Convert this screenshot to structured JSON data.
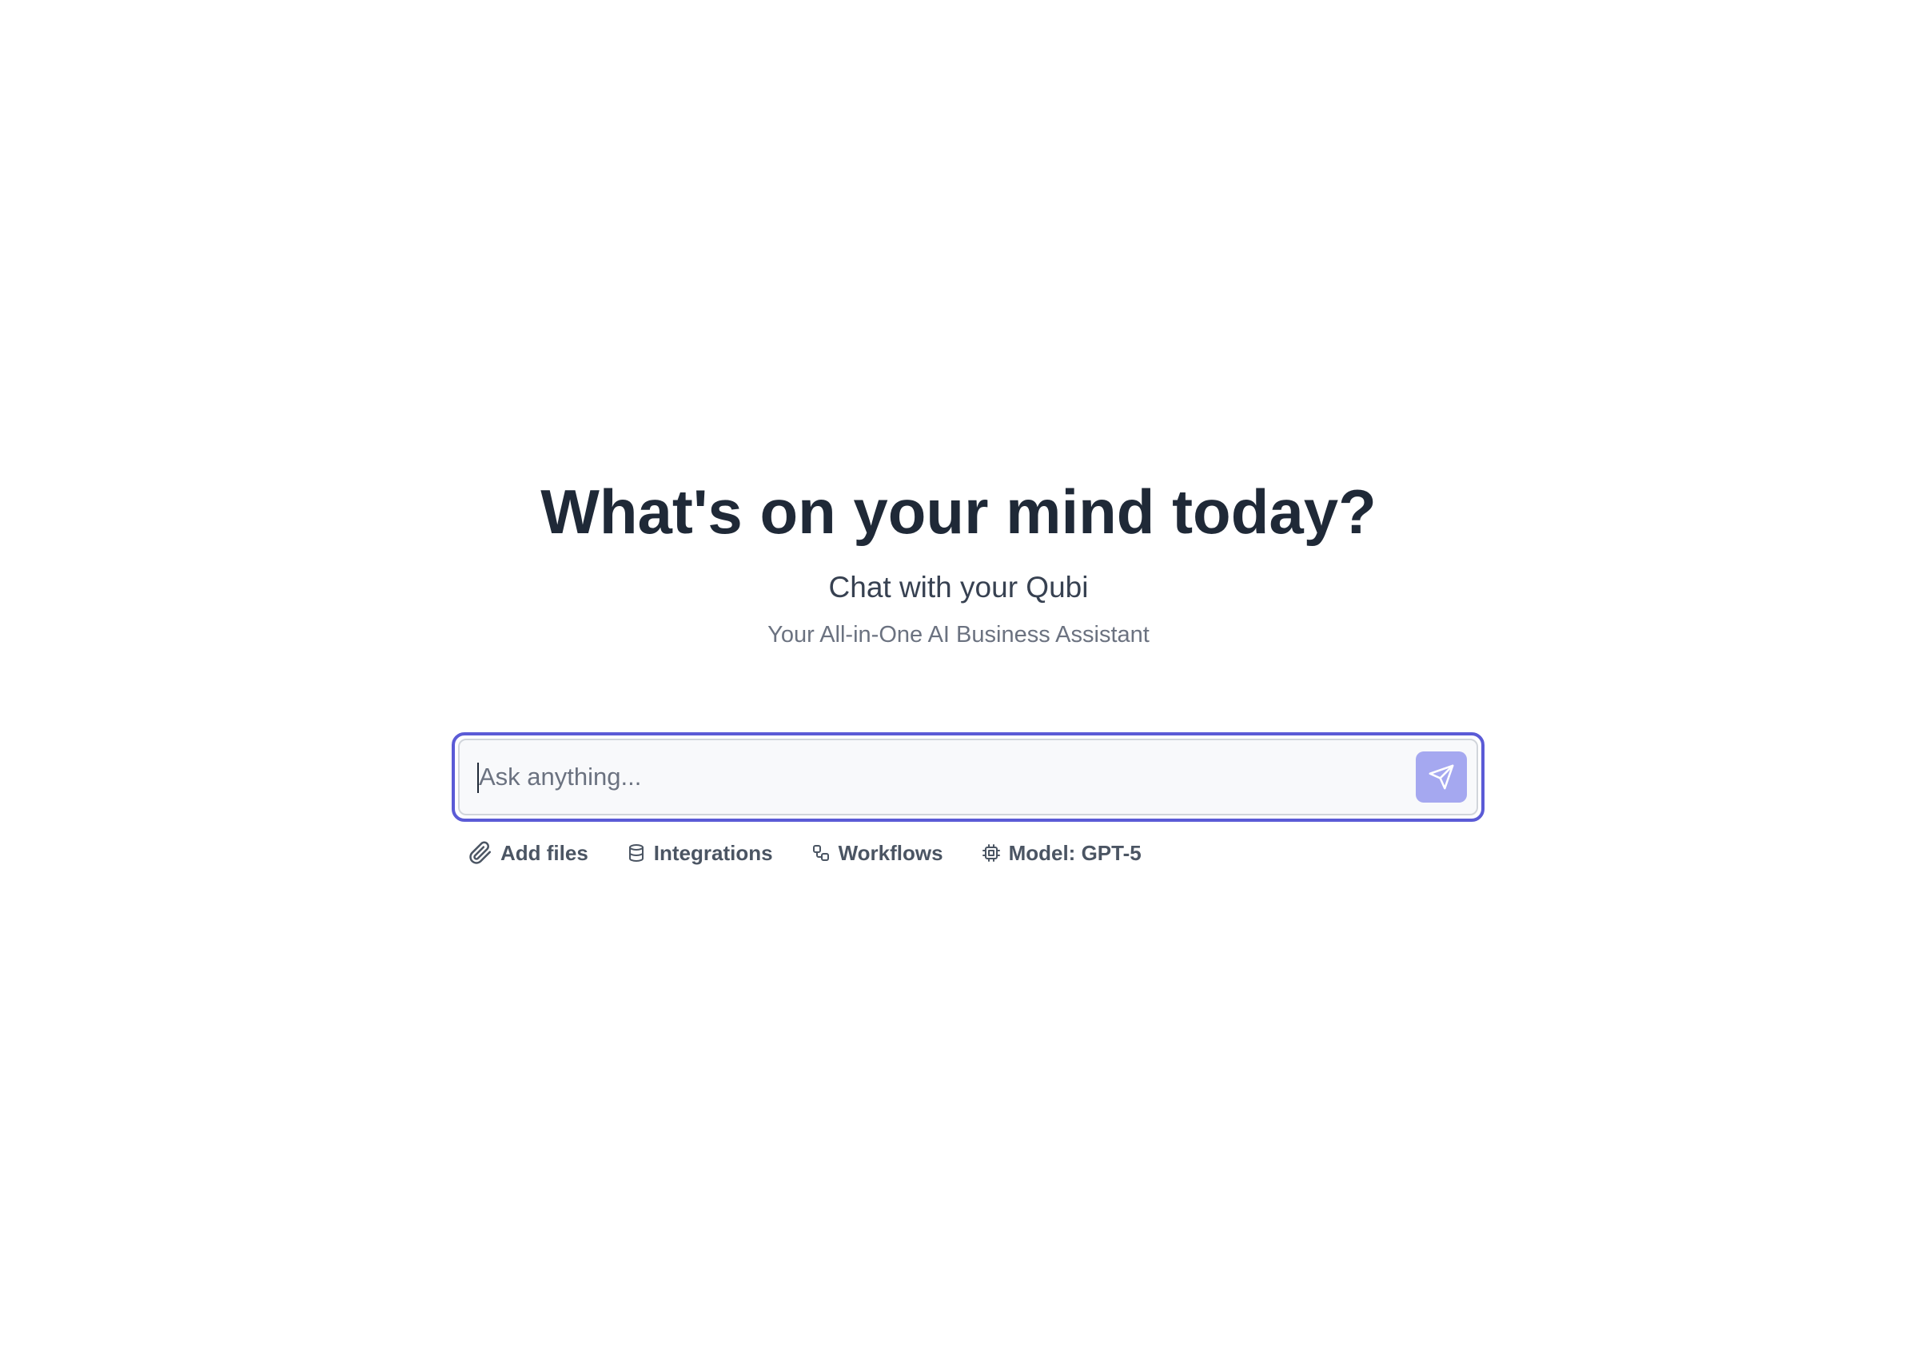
{
  "hero": {
    "headline": "What's on your mind today?",
    "subtitle": "Chat with your Qubi",
    "tagline": "Your All-in-One AI Business Assistant"
  },
  "composer": {
    "placeholder": "Ask anything...",
    "value": "",
    "send_icon": "send-icon",
    "focus_color": "#5b5bd6",
    "send_button_color": "#a5a8f0"
  },
  "toolbar": {
    "items": [
      {
        "label": "Add files",
        "icon": "paperclip-icon"
      },
      {
        "label": "Integrations",
        "icon": "database-icon"
      },
      {
        "label": "Workflows",
        "icon": "workflow-icon"
      },
      {
        "label": "Model: GPT-5",
        "icon": "cpu-icon"
      }
    ]
  }
}
